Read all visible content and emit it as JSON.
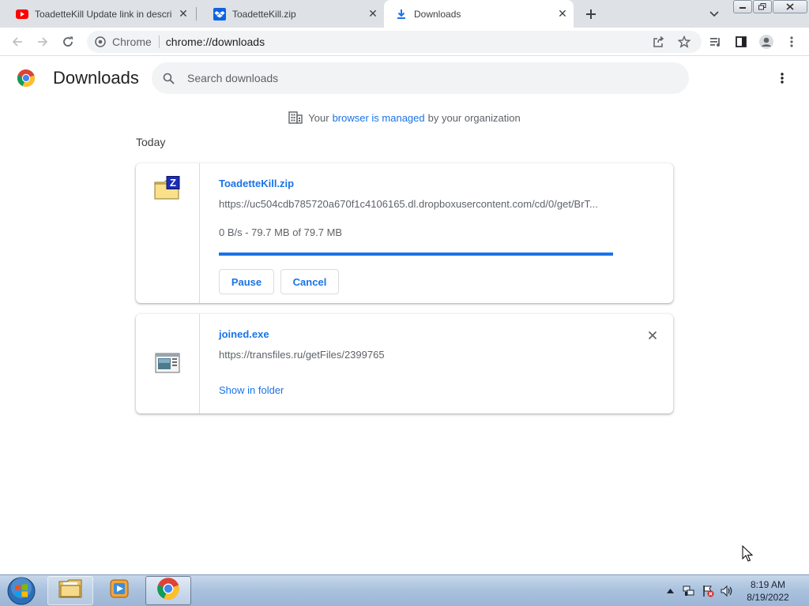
{
  "tabs": [
    {
      "title": "ToadetteKill Update link in descri",
      "icon": "youtube-icon"
    },
    {
      "title": "ToadetteKill.zip",
      "icon": "dropbox-icon"
    },
    {
      "title": "Downloads",
      "icon": "download-icon",
      "active": true
    }
  ],
  "toolbar": {
    "site_chip": "Chrome",
    "url": "chrome://downloads"
  },
  "downloads_page": {
    "title": "Downloads",
    "search_placeholder": "Search downloads",
    "managed_notice": {
      "prefix": "Your",
      "link": "browser is managed",
      "suffix": "by your organization"
    },
    "date_header": "Today",
    "items": [
      {
        "filename": "ToadetteKill.zip",
        "url": "https://uc504cdb785720a670f1c4106165.dl.dropboxusercontent.com/cd/0/get/BrT...",
        "status": "0 B/s - 79.7 MB of 79.7 MB",
        "progress_percent": 100,
        "buttons": [
          "Pause",
          "Cancel"
        ],
        "icon": "zip-file-icon"
      },
      {
        "filename": "joined.exe",
        "url": "https://transfiles.ru/getFiles/2399765",
        "link": "Show in folder",
        "icon": "exe-file-icon"
      }
    ]
  },
  "taskbar": {
    "time": "8:19 AM",
    "date": "8/19/2022"
  },
  "colors": {
    "accent": "#1a73e8",
    "tabstrip_bg": "#dee1e6",
    "omnibox_bg": "#f1f3f4",
    "text_secondary": "#5f6368"
  }
}
